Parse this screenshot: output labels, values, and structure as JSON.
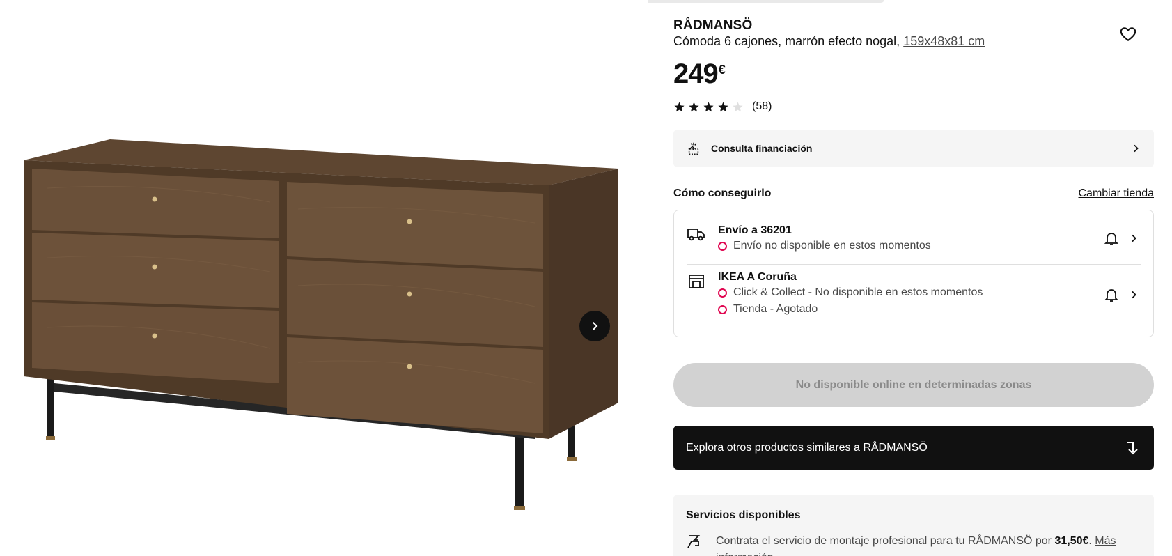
{
  "product": {
    "brand": "RÅDMANSÖ",
    "description": "Cómoda 6 cajones, marrón efecto nogal,",
    "dimensions": "159x48x81 cm",
    "price_main": "249",
    "price_currency": "€",
    "rating_value": 4,
    "rating_max": 5,
    "rating_count": "(58)"
  },
  "finance": {
    "label": "Consulta financiación"
  },
  "availability": {
    "heading": "Cómo conseguirlo",
    "change_store": "Cambiar tienda",
    "delivery": {
      "title": "Envío a 36201",
      "status": "Envío no disponible en estos momentos"
    },
    "store": {
      "title": "IKEA A Coruña",
      "status1": "Click & Collect - No disponible en estos momentos",
      "status2": "Tienda - Agotado"
    }
  },
  "buttons": {
    "unavailable": "No disponible online en determinadas zonas",
    "explore": "Explora otros productos similares a RÅDMANSÖ"
  },
  "services": {
    "title": "Servicios disponibles",
    "text_prefix": "Contrata el servicio de montaje profesional para tu RÅDMANSÖ por ",
    "price": "31,50€",
    "text_suffix": ". ",
    "link": "Más información"
  },
  "colors": {
    "accent_unavailable": "#e00751",
    "dark": "#111111"
  },
  "icons": {
    "favorite": "heart-icon",
    "next": "chevron-right-icon",
    "finance": "finance-icon",
    "delivery": "truck-icon",
    "store": "store-icon",
    "notify": "bell-icon",
    "explore": "arrow-down-icon",
    "assembly": "assembly-icon"
  }
}
